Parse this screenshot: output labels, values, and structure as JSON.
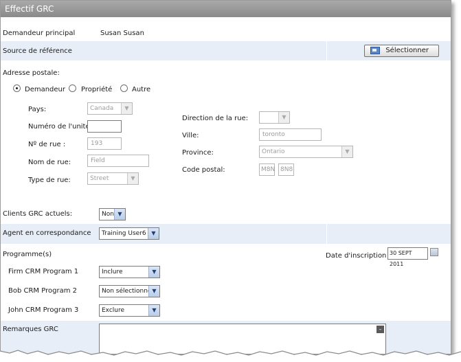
{
  "window": {
    "title": "Effectif GRC"
  },
  "requester": {
    "label": "Demandeur principal",
    "value": "Susan Susan"
  },
  "reference_source": {
    "label": "Source de référence",
    "select_button": "Sélectionner"
  },
  "address": {
    "label": "Adresse postale:",
    "radios": [
      {
        "label": "Demandeur",
        "checked": true
      },
      {
        "label": "Propriété",
        "checked": false
      },
      {
        "label": "Autre",
        "checked": false
      }
    ],
    "country": {
      "label": "Pays:",
      "value": "Canada"
    },
    "unit_number": {
      "label": "Numéro de l'unité:",
      "value": ""
    },
    "street_number": {
      "label": "Nº de rue :",
      "value": "193"
    },
    "street_name": {
      "label": "Nom de rue:",
      "value": "Field"
    },
    "street_type": {
      "label": "Type de rue:",
      "value": "Street"
    },
    "street_direction": {
      "label": "Direction de la rue:",
      "value": ""
    },
    "city": {
      "label": "Ville:",
      "value": "toronto"
    },
    "province": {
      "label": "Province:",
      "value": "Ontario"
    },
    "postal_code": {
      "label": "Code postal:",
      "part1": "M8N",
      "part2": "8N8"
    }
  },
  "current_clients": {
    "label": "Clients GRC actuels:",
    "value": "Non"
  },
  "agent": {
    "label": "Agent en correspondance",
    "value": "Training User6"
  },
  "programs": {
    "label": "Programme(s)",
    "enrollment_date_label": "Date d'inscription",
    "enrollment_date": "30 SEPT 2011",
    "items": [
      {
        "name": "Firm CRM Program 1",
        "value": "Inclure"
      },
      {
        "name": "Bob CRM Program 2",
        "value": "Non sélectionné"
      },
      {
        "name": "John CRM Program 3",
        "value": "Exclure"
      }
    ]
  },
  "remarks": {
    "label": "Remarques GRC",
    "scroll_up_glyph": "–"
  },
  "glyphs": {
    "dropdown": "▼"
  },
  "colors": {
    "titlebar": "#9a9a9a",
    "band": "#e8eef7",
    "accent": "#1d3f7a"
  }
}
